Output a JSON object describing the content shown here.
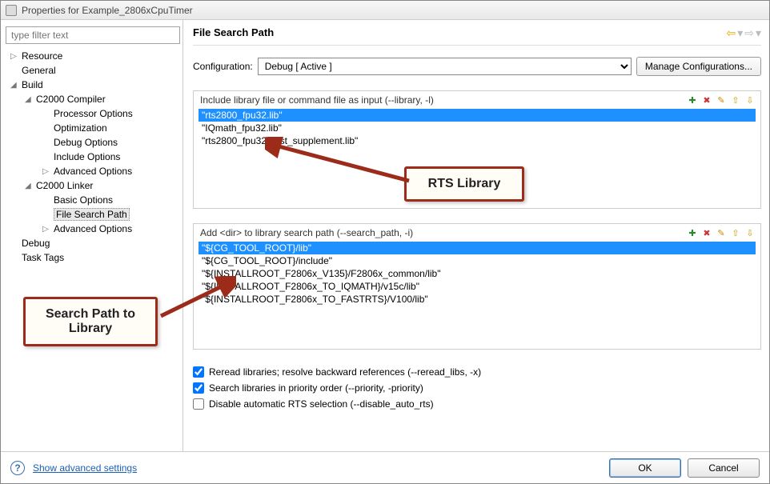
{
  "window": {
    "title": "Properties for Example_2806xCpuTimer"
  },
  "filter": {
    "placeholder": "type filter text"
  },
  "tree": {
    "resource": "Resource",
    "general": "General",
    "build": "Build",
    "c2000compiler": "C2000 Compiler",
    "processorOptions": "Processor Options",
    "optimization": "Optimization",
    "debugOptions": "Debug Options",
    "includeOptions": "Include Options",
    "advancedOptions1": "Advanced Options",
    "c2000linker": "C2000 Linker",
    "basicOptions": "Basic Options",
    "fileSearchPath": "File Search Path",
    "advancedOptions2": "Advanced Options",
    "debug": "Debug",
    "taskTags": "Task Tags"
  },
  "page": {
    "title": "File Search Path",
    "configLabel": "Configuration:",
    "configValue": "Debug  [ Active ]",
    "manage": "Manage Configurations..."
  },
  "group1": {
    "label": "Include library file or command file as input (--library, -l)",
    "items": [
      "\"rts2800_fpu32.lib\"",
      "\"IQmath_fpu32.lib\"",
      "\"rts2800_fpu32_fast_supplement.lib\""
    ]
  },
  "group2": {
    "label": "Add <dir> to library search path (--search_path, -i)",
    "items": [
      "\"${CG_TOOL_ROOT}/lib\"",
      "\"${CG_TOOL_ROOT}/include\"",
      "\"${INSTALLROOT_F2806x_V135}/F2806x_common/lib\"",
      "\"${INSTALLROOT_F2806x_TO_IQMATH}/v15c/lib\"",
      "\"${INSTALLROOT_F2806x_TO_FASTRTS}/V100/lib\""
    ]
  },
  "checks": {
    "reread": "Reread libraries; resolve backward references (--reread_libs, -x)",
    "priority": "Search libraries in priority order (--priority, -priority)",
    "disableAuto": "Disable automatic RTS selection (--disable_auto_rts)"
  },
  "footer": {
    "advanced": "Show advanced settings",
    "ok": "OK",
    "cancel": "Cancel"
  },
  "callouts": {
    "rts": "RTS Library",
    "searchPath": "Search Path to\nLibrary"
  }
}
